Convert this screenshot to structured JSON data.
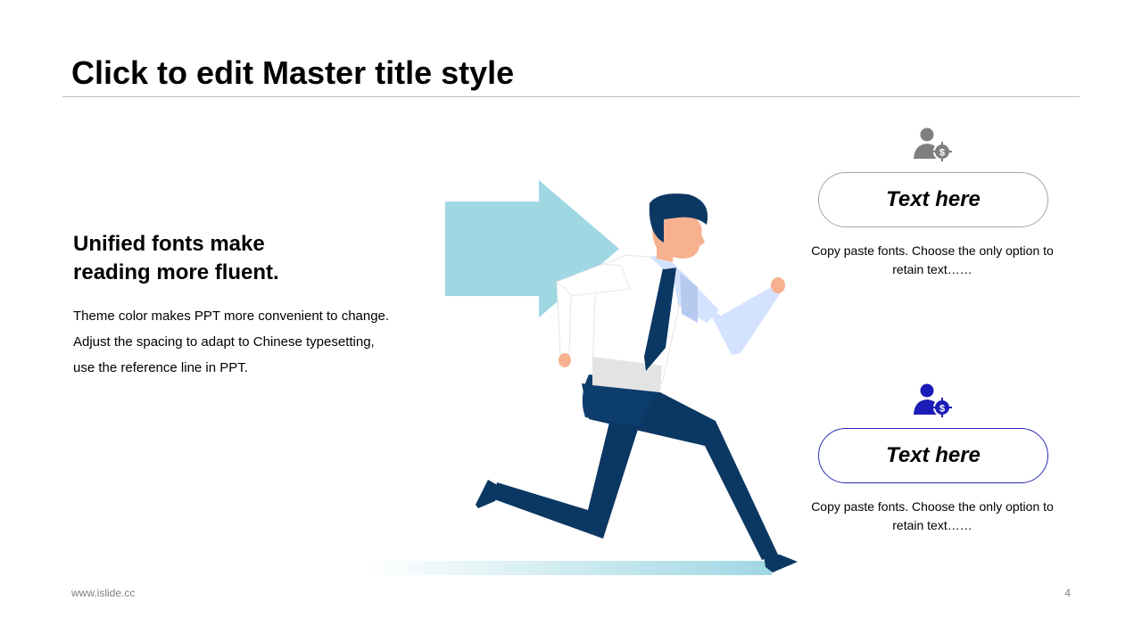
{
  "slide": {
    "title": "Click to edit Master title style",
    "page_number": "4",
    "footer_url": "www.islide.cc"
  },
  "left": {
    "heading_line1": "Unified fonts make",
    "heading_line2": "reading more fluent.",
    "body_lines": [
      "Theme color makes PPT more convenient to change.",
      "Adjust the spacing to adapt to Chinese typesetting,",
      "use the reference line in PPT."
    ]
  },
  "cards": [
    {
      "icon": "user-dollar-icon",
      "icon_color": "#7f7f7f",
      "label": "Text here",
      "desc_line1": "Copy paste fonts. Choose the only option to",
      "desc_line2": "retain text……"
    },
    {
      "icon": "user-dollar-icon",
      "icon_color": "#1c1cb8",
      "label": "Text here",
      "desc_line1": "Copy paste fonts. Choose the only option to",
      "desc_line2": "retain text……"
    }
  ],
  "colors": {
    "arrow": "#9fd7e3",
    "suit": "#0b3763",
    "skin": "#f8b18f",
    "shirt": "#ffffff",
    "sleeve": "#d3e3ff"
  }
}
